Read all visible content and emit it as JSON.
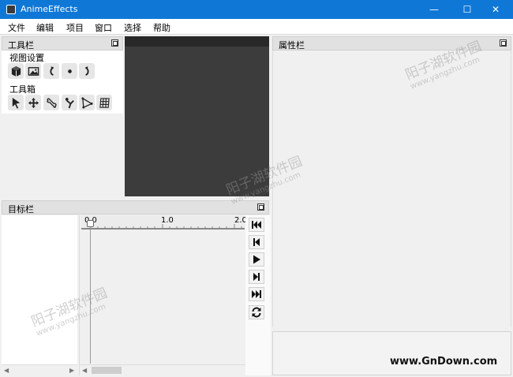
{
  "window": {
    "title": "AnimeEffects",
    "minimize": "—",
    "maximize": "☐",
    "close": "✕"
  },
  "menu": [
    "文件",
    "编辑",
    "项目",
    "窗口",
    "选择",
    "帮助"
  ],
  "toolbar_panel": {
    "title": "工具栏",
    "view_settings_label": "视图设置",
    "view_tools": [
      "cube-icon",
      "image-icon",
      "rotate-left-icon",
      "dot-icon",
      "rotate-right-icon"
    ],
    "toolbox_label": "工具箱",
    "tools": [
      "cursor-icon",
      "move-icon",
      "bone-icon",
      "pose-icon",
      "mesh-triangle-icon",
      "mesh-grid-icon"
    ]
  },
  "property_panel": {
    "title": "属性栏"
  },
  "target_panel": {
    "title": "目标栏"
  },
  "timeline": {
    "ticks": [
      "0.0",
      "1.0",
      "2.0"
    ]
  },
  "playback": [
    "skip-back-icon",
    "step-back-icon",
    "play-icon",
    "step-forward-icon",
    "skip-forward-icon",
    "loop-icon"
  ],
  "watermark": {
    "text_cn": "阳子湖软件园",
    "text_url": "www.yangzhu.com",
    "site": "www.GnDown.com"
  },
  "colors": {
    "titlebar": "#0f78d7",
    "canvas": "#3c3c3c",
    "panel": "#f0f0f0"
  }
}
